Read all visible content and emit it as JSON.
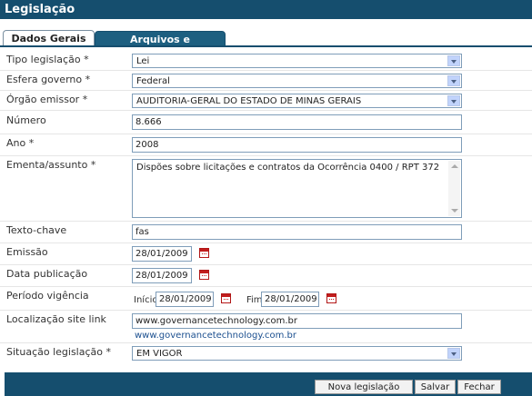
{
  "window": {
    "title": "Legislação"
  },
  "tabs": [
    {
      "label": "Dados Gerais",
      "active": true
    },
    {
      "label": "Arquivos e documentos",
      "active": false
    }
  ],
  "form": {
    "tipo_legislacao": {
      "label": "Tipo legislação",
      "required": "*",
      "value": "Lei"
    },
    "esfera_governo": {
      "label": "Esfera governo",
      "required": "*",
      "value": "Federal"
    },
    "orgao_emissor": {
      "label": "Órgão emissor",
      "required": "*",
      "value": "AUDITORIA-GERAL DO ESTADO DE MINAS GERAIS"
    },
    "numero": {
      "label": "Número",
      "value": "8.666"
    },
    "ano": {
      "label": "Ano",
      "required": "*",
      "value": "2008"
    },
    "ementa": {
      "label": "Ementa/assunto",
      "required": "*",
      "value": "Dispões sobre licitações e contratos da Ocorrência 0400 / RPT 372"
    },
    "texto_chave": {
      "label": "Texto-chave",
      "value": "fas"
    },
    "emissao": {
      "label": "Emissão",
      "value": "28/01/2009"
    },
    "data_publicacao": {
      "label": "Data publicação",
      "value": "28/01/2009"
    },
    "periodo_vigencia": {
      "label": "Período vigência",
      "inicio_label": "Início",
      "inicio_value": "28/01/2009",
      "fim_label": "Fim",
      "fim_value": "28/01/2009"
    },
    "localizacao": {
      "label": "Localização site link",
      "value": "www.governancetechnology.com.br",
      "link": "www.governancetechnology.com.br"
    },
    "situacao": {
      "label": "Situação legislação",
      "required": "*",
      "value": "EM VIGOR"
    }
  },
  "buttons": {
    "nova": "Nova legislação",
    "salvar": "Salvar",
    "fechar": "Fechar"
  },
  "colors": {
    "header": "#154e6e",
    "tab_inactive": "#1d5f80",
    "link": "#1b4f8f"
  },
  "icons": {
    "calendar": "calendar-icon",
    "dropdown": "chevron-down-icon"
  }
}
